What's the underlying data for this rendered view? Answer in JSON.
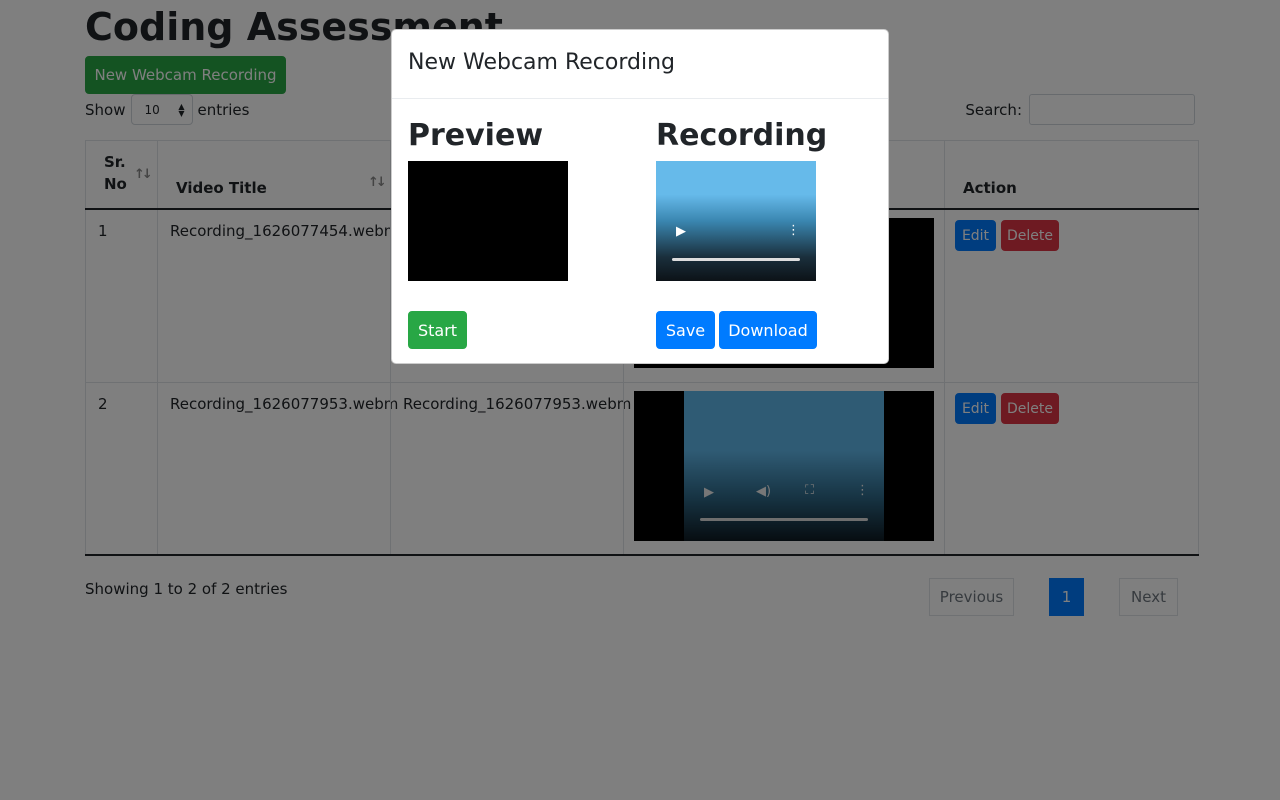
{
  "page": {
    "title": "Coding Assessment",
    "new_recording_button": "New Webcam Recording"
  },
  "table_controls": {
    "show_label": "Show",
    "page_length": "10",
    "entries_label": "entries",
    "search_label": "Search:",
    "search_value": ""
  },
  "table": {
    "headers": [
      "Sr. No",
      "Video Title",
      "",
      "",
      "Action"
    ],
    "header_sr_line1": "Sr.",
    "header_sr_line2": "No",
    "rows": [
      {
        "sr": "1",
        "title": "Recording_1626077454.webm",
        "file": "",
        "edit": "Edit",
        "delete": "Delete"
      },
      {
        "sr": "2",
        "title": "Recording_1626077953.webm",
        "file": "Recording_1626077953.webm",
        "edit": "Edit",
        "delete": "Delete"
      }
    ]
  },
  "footer": {
    "info": "Showing 1 to 2 of 2 entries",
    "previous": "Previous",
    "current_page": "1",
    "next": "Next"
  },
  "modal": {
    "title": "New Webcam Recording",
    "preview_heading": "Preview",
    "recording_heading": "Recording",
    "start_button": "Start",
    "save_button": "Save",
    "download_button": "Download"
  },
  "icons": {
    "sort": "sort-icon",
    "play": "play-icon",
    "more": "more-vertical-icon",
    "mute": "volume-icon",
    "fullscreen": "fullscreen-icon"
  },
  "colors": {
    "success": "#28a745",
    "primary": "#007bff",
    "danger": "#dc3545"
  }
}
